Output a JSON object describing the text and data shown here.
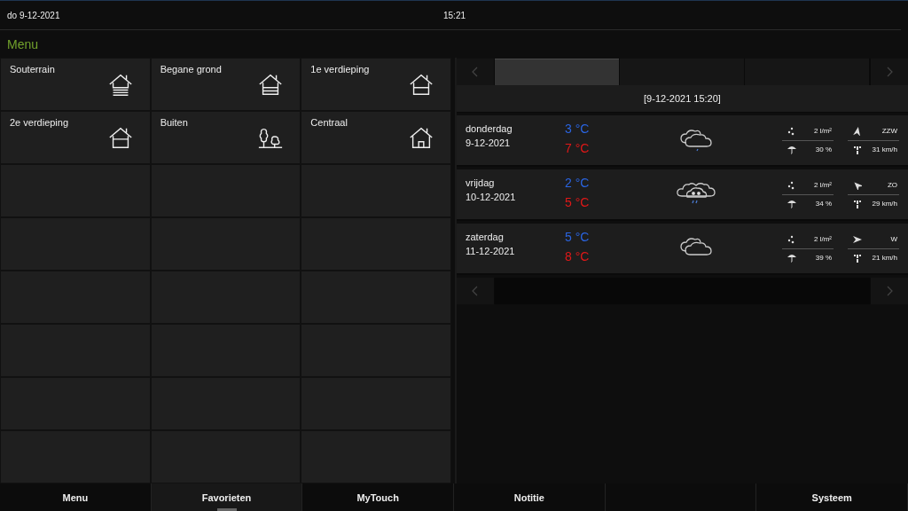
{
  "status_bar": {
    "date": "do  9-12-2021",
    "time": "15:21"
  },
  "title": "Menu",
  "rooms": [
    {
      "label": "Souterrain",
      "kind": "basement"
    },
    {
      "label": "Begane grond",
      "kind": "ground"
    },
    {
      "label": "1e verdieping",
      "kind": "first"
    },
    {
      "label": "2e verdieping",
      "kind": "second"
    },
    {
      "label": "Buiten",
      "kind": "garden"
    },
    {
      "label": "Centraal",
      "kind": "central"
    }
  ],
  "weather": {
    "tabs": [
      {
        "selected": true
      },
      {
        "selected": false
      },
      {
        "selected": false
      }
    ],
    "updated": "[9-12-2021 15:20]",
    "days": [
      {
        "day": "donderdag",
        "date": "9-12-2021",
        "low": "3 °C",
        "high": "7 °C",
        "kind": "rain",
        "rain": "2 l/m²",
        "chance": "30 %",
        "wind_dir": "ZZW",
        "wind_speed": "31 km/h"
      },
      {
        "day": "vrijdag",
        "date": "10-12-2021",
        "low": "2 °C",
        "high": "5 °C",
        "kind": "snow",
        "rain": "2 l/m²",
        "chance": "34 %",
        "wind_dir": "ZO",
        "wind_speed": "29 km/h"
      },
      {
        "day": "zaterdag",
        "date": "11-12-2021",
        "low": "5 °C",
        "high": "8 °C",
        "kind": "cloudy",
        "rain": "2 l/m²",
        "chance": "39 %",
        "wind_dir": "W",
        "wind_speed": "21 km/h"
      }
    ]
  },
  "nav": [
    {
      "label": "Menu",
      "selected": false
    },
    {
      "label": "Favorieten",
      "selected": true
    },
    {
      "label": "MyTouch",
      "selected": false
    },
    {
      "label": "Notitie",
      "selected": false
    },
    {
      "selected": false
    },
    {
      "label": "Systeem",
      "selected": false
    }
  ]
}
